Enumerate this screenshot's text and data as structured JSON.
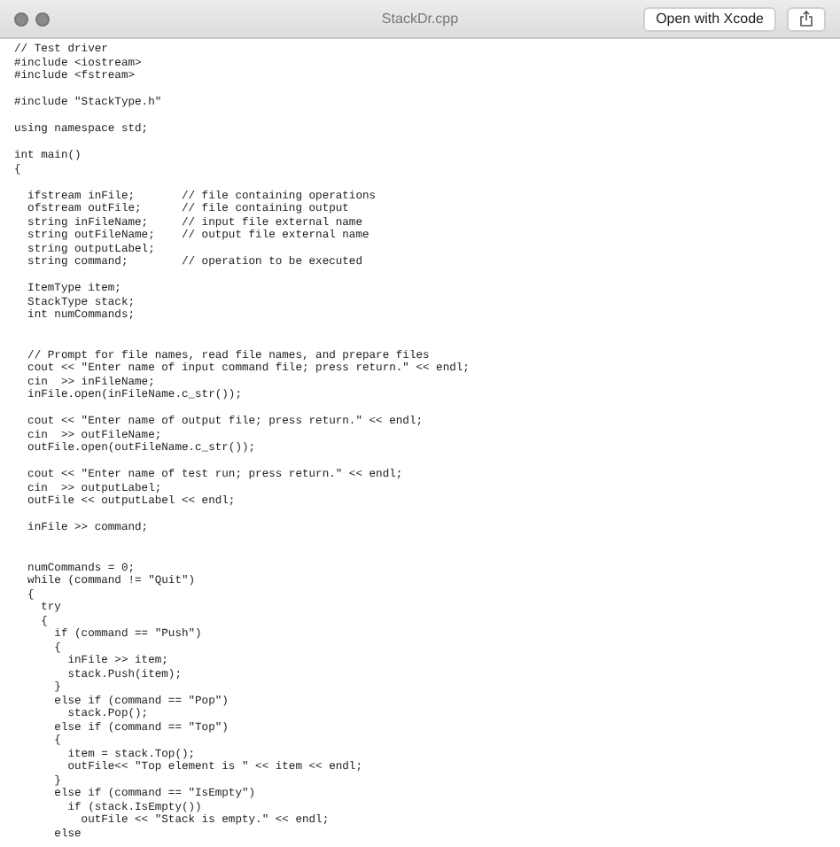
{
  "window": {
    "title": "StackDr.cpp",
    "open_button": "Open with Xcode"
  },
  "code_sections": [
    {
      "blocks": [
        [
          "// Test driver",
          "#include <iostream>",
          "#include <fstream>"
        ],
        [
          "#include \"StackType.h\""
        ],
        [
          "using namespace std;"
        ],
        [
          "int main()",
          "{"
        ],
        [
          "  ifstream inFile;       // file containing operations",
          "  ofstream outFile;      // file containing output",
          "  string inFileName;     // input file external name",
          "  string outFileName;    // output file external name",
          "  string outputLabel;",
          "  string command;        // operation to be executed"
        ],
        [
          "  ItemType item;",
          "  StackType stack;",
          "  int numCommands;"
        ]
      ]
    },
    {
      "blocks": [
        [
          "  // Prompt for file names, read file names, and prepare files",
          "  cout << \"Enter name of input command file; press return.\" << endl;",
          "  cin  >> inFileName;",
          "  inFile.open(inFileName.c_str());"
        ],
        [
          "  cout << \"Enter name of output file; press return.\" << endl;",
          "  cin  >> outFileName;",
          "  outFile.open(outFileName.c_str());"
        ],
        [
          "  cout << \"Enter name of test run; press return.\" << endl;",
          "  cin  >> outputLabel;",
          "  outFile << outputLabel << endl;"
        ],
        [
          "  inFile >> command;"
        ]
      ]
    },
    {
      "blocks": [
        [
          "  numCommands = 0;",
          "  while (command != \"Quit\")",
          "  {",
          "    try",
          "    {",
          "      if (command == \"Push\")",
          "      {",
          "        inFile >> item;",
          "        stack.Push(item);",
          "      }",
          "      else if (command == \"Pop\")",
          "        stack.Pop();",
          "      else if (command == \"Top\")",
          "      {",
          "        item = stack.Top();",
          "        outFile<< \"Top element is \" << item << endl;",
          "      }",
          "      else if (command == \"IsEmpty\")",
          "        if (stack.IsEmpty())",
          "          outFile << \"Stack is empty.\" << endl;",
          "      else"
        ]
      ]
    }
  ]
}
